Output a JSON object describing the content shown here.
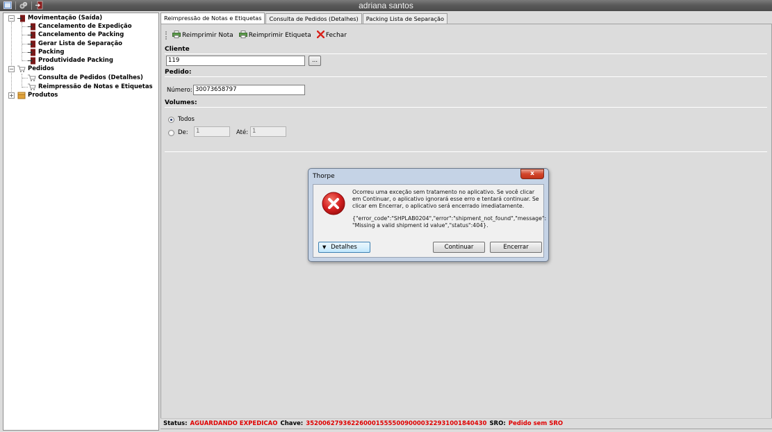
{
  "window": {
    "title": "adriana santos"
  },
  "quick_access": {
    "icons": [
      "window-icon",
      "gears-icon",
      "exit-door-icon"
    ]
  },
  "tree": {
    "movimentacao": {
      "label": "Movimentação (Saída)",
      "items": [
        "Cancelamento de Expedição",
        "Cancelamento de Packing",
        "Gerar Lista de Separação",
        "Packing",
        "Produtividade Packing"
      ]
    },
    "pedidos": {
      "label": "Pedidos",
      "items": [
        "Consulta de Pedidos (Detalhes)",
        "Reimpressão de Notas e Etiquetas"
      ]
    },
    "produtos": {
      "label": "Produtos"
    }
  },
  "tabs": [
    "Reimpressão de Notas e Etiquetas",
    "Consulta de Pedidos (Detalhes)",
    "Packing Lista de Separação"
  ],
  "toolbar": {
    "reimprimir_nota": "Reimprimir Nota",
    "reimprimir_etiqueta": "Reimprimir Etiqueta",
    "fechar": "Fechar"
  },
  "cliente": {
    "section": "Cliente",
    "value": "119",
    "browse": "..."
  },
  "pedido": {
    "section": "Pedido:",
    "numero_label": "Número:",
    "numero_value": "30073658797"
  },
  "volumes": {
    "section": "Volumes:",
    "todos": "Todos",
    "de_label": "De:",
    "de_value": "1",
    "ate_label": "Até:",
    "ate_value": "1",
    "selected": "Todos"
  },
  "status": {
    "status_label": "Status:",
    "status_value": "AGUARDANDO EXPEDICAO",
    "chave_label": "Chave:",
    "chave_value": "35200627936226000155550090000322931001840430",
    "sro_label": "SRO:",
    "sro_value": "Pedido sem SRO"
  },
  "dialog": {
    "title": "Thorpe",
    "close": "x",
    "message": "Ocorreu uma exceção sem tratamento no aplicativo. Se você clicar em Continuar, o aplicativo ignorará esse erro e tentará continuar. Se clicar em Encerrar, o aplicativo será encerrado imediatamente.",
    "detail": "{\"error_code\":\"SHPLAB0204\",\"error\":\"shipment_not_found\",\"message\": \"Missing a valid shipment id value\",\"status\":404}.",
    "detalhes_button": "Detalhes",
    "continuar_button": "Continuar",
    "encerrar_button": "Encerrar"
  },
  "colors": {
    "status_red": "#e00000",
    "dialog_frame": "#c5d3e6",
    "error_icon": "#d42020"
  }
}
